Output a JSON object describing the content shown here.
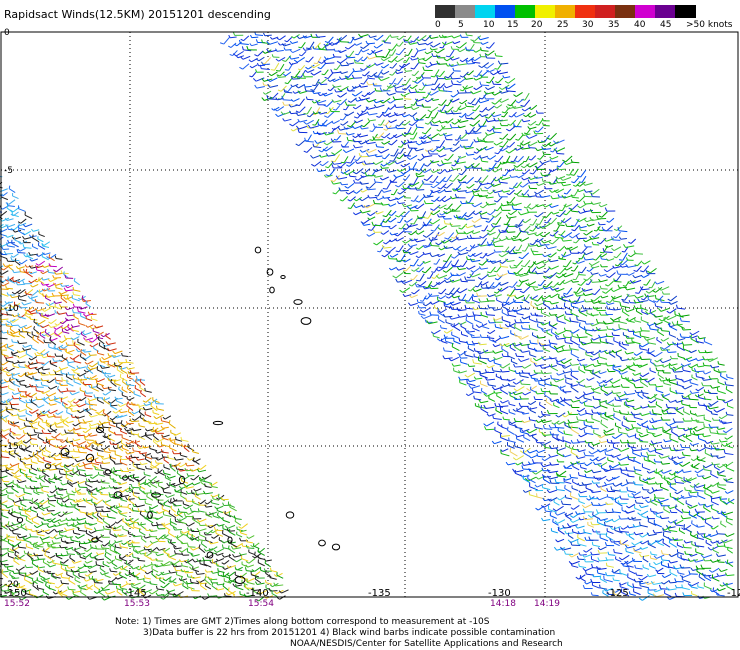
{
  "header": {
    "title": "Rapidsact Winds(12.5KM) 20151201 descending"
  },
  "colorbar": {
    "colors": [
      "#303030",
      "#8a8a8a",
      "#00d4f0",
      "#0050f0",
      "#00c000",
      "#f0f000",
      "#f0b000",
      "#f03010",
      "#d02020",
      "#7a3010",
      "#d000d0",
      "#6a0090",
      "#000000"
    ],
    "labels": [
      "0",
      "5",
      "10",
      "15",
      "20",
      "25",
      "30",
      "35",
      "40",
      "45",
      ">50 knots"
    ]
  },
  "axes": {
    "lon_labels": [
      "-150",
      "-145",
      "-140",
      "-135",
      "-130",
      "-125",
      "-12"
    ],
    "lat_labels": [
      "0",
      "-5",
      "-10",
      "-15",
      "-20"
    ]
  },
  "time_labels": [
    "15:52",
    "15:53",
    "15:54",
    "14:18",
    "14:19"
  ],
  "notes": {
    "line1": "Note: 1) Times are GMT 2)Times along bottom correspond to measurement at -10S",
    "line2": "3)Data buffer is 22 hrs from 20151201 4) Black wind barbs indicate possible contamination",
    "line3": "NOAA/NESDIS/Center for Satellite Applications and Research"
  }
}
